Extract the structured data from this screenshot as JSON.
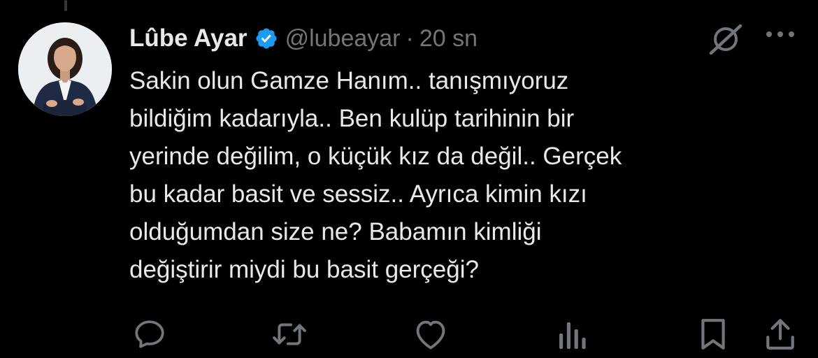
{
  "author": {
    "display_name": "Lûbe Ayar",
    "handle": "@lubeayar",
    "separator": "·",
    "time": "20 sn",
    "verified": true
  },
  "tweet": {
    "lines": [
      "Sakin olun Gamze Hanım.. tanışmıyoruz",
      "bildiğim kadarıyla.. Ben kulüp tarihinin bir",
      "yerinde değilim, o küçük kız da değil.. Gerçek",
      "bu kadar basit ve sessiz.. Ayrıca kimin kızı",
      "olduğumdan size ne? Babamın kimliği",
      "değiştirir miydi bu basit gerçeği?"
    ]
  },
  "actions": [
    "reply-icon",
    "retweet-icon",
    "like-icon",
    "views-icon",
    "bookmark-icon",
    "share-icon"
  ],
  "colors": {
    "background": "#000000",
    "text": "#e7e9ea",
    "secondary": "#71767b",
    "verified": "#1d9bf0"
  }
}
